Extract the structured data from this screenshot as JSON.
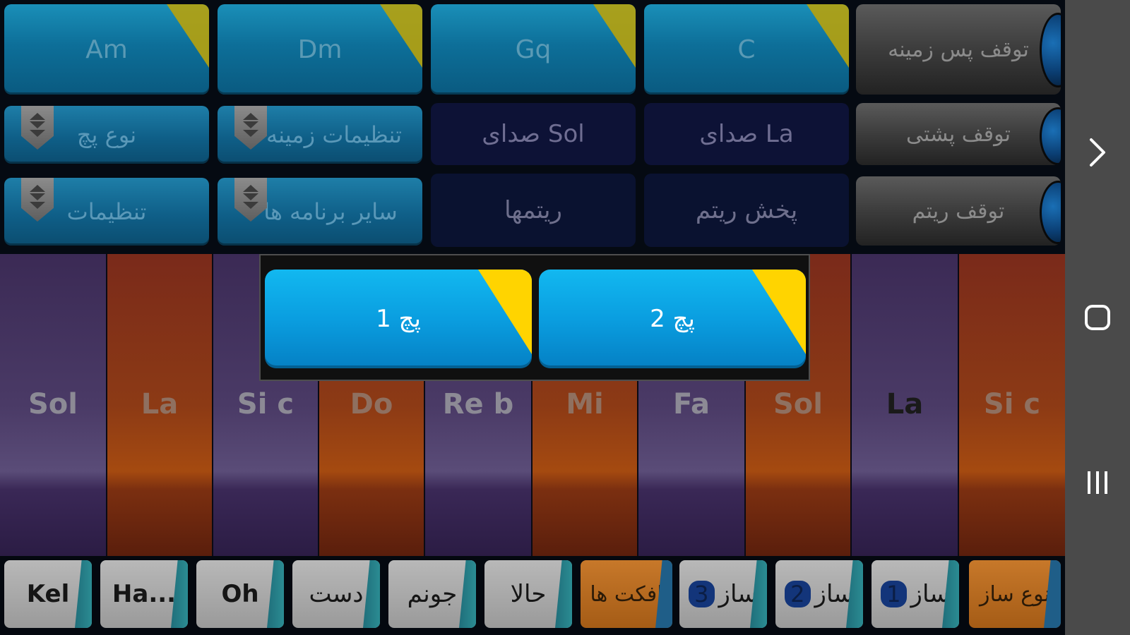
{
  "chords": [
    {
      "label": "Am"
    },
    {
      "label": "Dm"
    },
    {
      "label": "Gq"
    },
    {
      "label": "C"
    }
  ],
  "stop_buttons": [
    {
      "label": "توقف پس زمینه"
    },
    {
      "label": "توقف پشتی"
    },
    {
      "label": "توقف ریتم"
    }
  ],
  "row2": {
    "patch_type": "نوع پچ",
    "background_settings": "تنظیمات زمینه",
    "sound_sol": "صدای Sol",
    "sound_la": "صدای La"
  },
  "row3": {
    "settings": "تنظیمات",
    "other_apps": "سایر برنامه ها",
    "rhythms": "ریتمها",
    "play_rhythm": "پخش ریتم"
  },
  "piano_keys": [
    {
      "label": "Sol",
      "color": "purple"
    },
    {
      "label": "La",
      "color": "orange"
    },
    {
      "label": "Si c",
      "color": "purple"
    },
    {
      "label": "Do",
      "color": "orange"
    },
    {
      "label": "Re b",
      "color": "purple"
    },
    {
      "label": "Mi",
      "color": "orange"
    },
    {
      "label": "Fa",
      "color": "purple"
    },
    {
      "label": "Sol",
      "color": "orange"
    },
    {
      "label": "La",
      "color": "purple"
    },
    {
      "label": "Si c",
      "color": "orange"
    }
  ],
  "popup": {
    "options": [
      {
        "label": "پچ 1"
      },
      {
        "label": "پچ 2"
      }
    ]
  },
  "bottom_bar": [
    {
      "label": "Kel"
    },
    {
      "label": "Ha..."
    },
    {
      "label": "Oh"
    },
    {
      "label": "دست"
    },
    {
      "label": "جونم"
    },
    {
      "label": "حالا"
    },
    {
      "label": "افکت ها"
    },
    {
      "label": "ساز",
      "num": "3"
    },
    {
      "label": "ساز",
      "num": "2"
    },
    {
      "label": "ساز",
      "num": "1"
    },
    {
      "label": "نوع ساز"
    }
  ],
  "nav": {
    "forward_icon": "chevron-right-icon",
    "home_icon": "home-square-icon",
    "recents_icon": "recents-bars-icon"
  },
  "colors": {
    "chord_blue": "#0d6f99",
    "corner_yellow": "#b7a20c",
    "popup_blue": "#0a9ee0",
    "popup_corner": "#ffd400",
    "piano_purple": "#4a3a66",
    "piano_orange": "#8c3a15"
  }
}
